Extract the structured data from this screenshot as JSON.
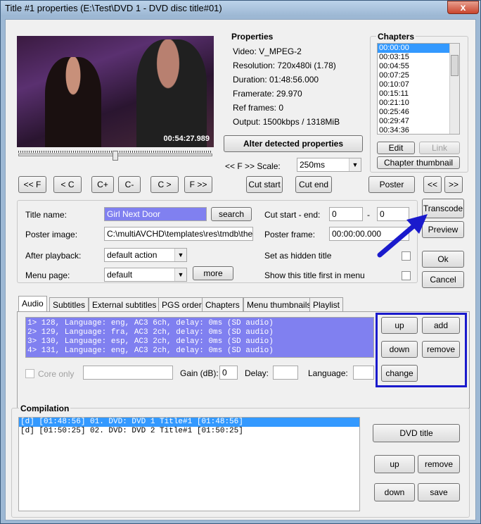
{
  "window": {
    "title": "Title #1 properties (E:\\Test\\DVD 1 - DVD disc title#01)",
    "close_glyph": "x"
  },
  "video": {
    "timestamp": "00:54:27.989"
  },
  "properties": {
    "header": "Properties",
    "lines": [
      "Video: V_MPEG-2",
      "Resolution: 720x480i (1.78)",
      "Duration: 01:48:56.000",
      "Framerate: 29.970",
      "Ref frames: 0",
      "Output: 1500kbps / 1318MiB"
    ],
    "alter_button": "Alter detected properties",
    "scale_label": "<< F >> Scale:",
    "scale_value": "250ms"
  },
  "chapters": {
    "header": "Chapters",
    "items": [
      "00:00:00",
      "00:03:15",
      "00:04:55",
      "00:07:25",
      "00:10:07",
      "00:15:11",
      "00:21:10",
      "00:25:46",
      "00:29:47",
      "00:34:36"
    ],
    "edit_label": "Edit",
    "link_label": "Link",
    "thumb_label": "Chapter thumbnail"
  },
  "nav": {
    "prev_f": "<< F",
    "prev_c": "< C",
    "c_plus": "C+",
    "c_minus": "C-",
    "next_c": "C >",
    "next_f": "F >>",
    "cut_start": "Cut start",
    "cut_end": "Cut end",
    "poster": "Poster",
    "prev": "<<",
    "next": ">>"
  },
  "form": {
    "title_label": "Title name:",
    "title_value": "Girl Next Door",
    "search_label": "search",
    "poster_label": "Poster image:",
    "poster_value": "C:\\multiAVCHD\\templates\\res\\tmdb\\the-girl",
    "after_label": "After playback:",
    "after_value": "default action",
    "menu_label": "Menu page:",
    "menu_value": "default",
    "more_label": "more",
    "cut_label": "Cut start - end:",
    "cut_start": "0",
    "cut_dash": "-",
    "cut_end": "0",
    "poster_frame_label": "Poster frame:",
    "poster_frame_value": "00:00:00.000",
    "hidden_label": "Set as hidden title",
    "first_label": "Show this title first in menu"
  },
  "side": {
    "transcode": "Transcode",
    "preview": "Preview",
    "ok": "Ok",
    "cancel": "Cancel"
  },
  "tabs": [
    "Audio",
    "Subtitles",
    "External subtitles",
    "PGS order",
    "Chapters",
    "Menu thumbnails",
    "Playlist"
  ],
  "audio": {
    "tracks": [
      "1> 128, Language: eng, AC3 6ch, delay: 0ms (SD audio)",
      "2> 129, Language: fra, AC3 2ch, delay: 0ms (SD audio)",
      "3> 130, Language: esp, AC3 2ch, delay: 0ms (SD audio)",
      "4> 131, Language: eng, AC3 2ch, delay: 0ms (SD audio)"
    ],
    "up": "up",
    "add": "add",
    "down": "down",
    "remove": "remove",
    "change": "change",
    "core_only": "Core only",
    "gain_label": "Gain (dB):",
    "gain_value": "0",
    "delay_label": "Delay:",
    "language_label": "Language:"
  },
  "compilation": {
    "header": "Compilation",
    "items": [
      "[d] [01:48:56] 01. DVD: DVD 1 Title#1 [01:48:56]",
      "[d] [01:50:25] 02. DVD: DVD 2 Title#1 [01:50:25]"
    ],
    "dvd_title": "DVD title",
    "up": "up",
    "remove": "remove",
    "down": "down",
    "save": "save"
  },
  "colors": {
    "highlight_blue": "#3399ff",
    "track_bg": "#8080f0",
    "annotation_blue": "#1a1acc"
  }
}
